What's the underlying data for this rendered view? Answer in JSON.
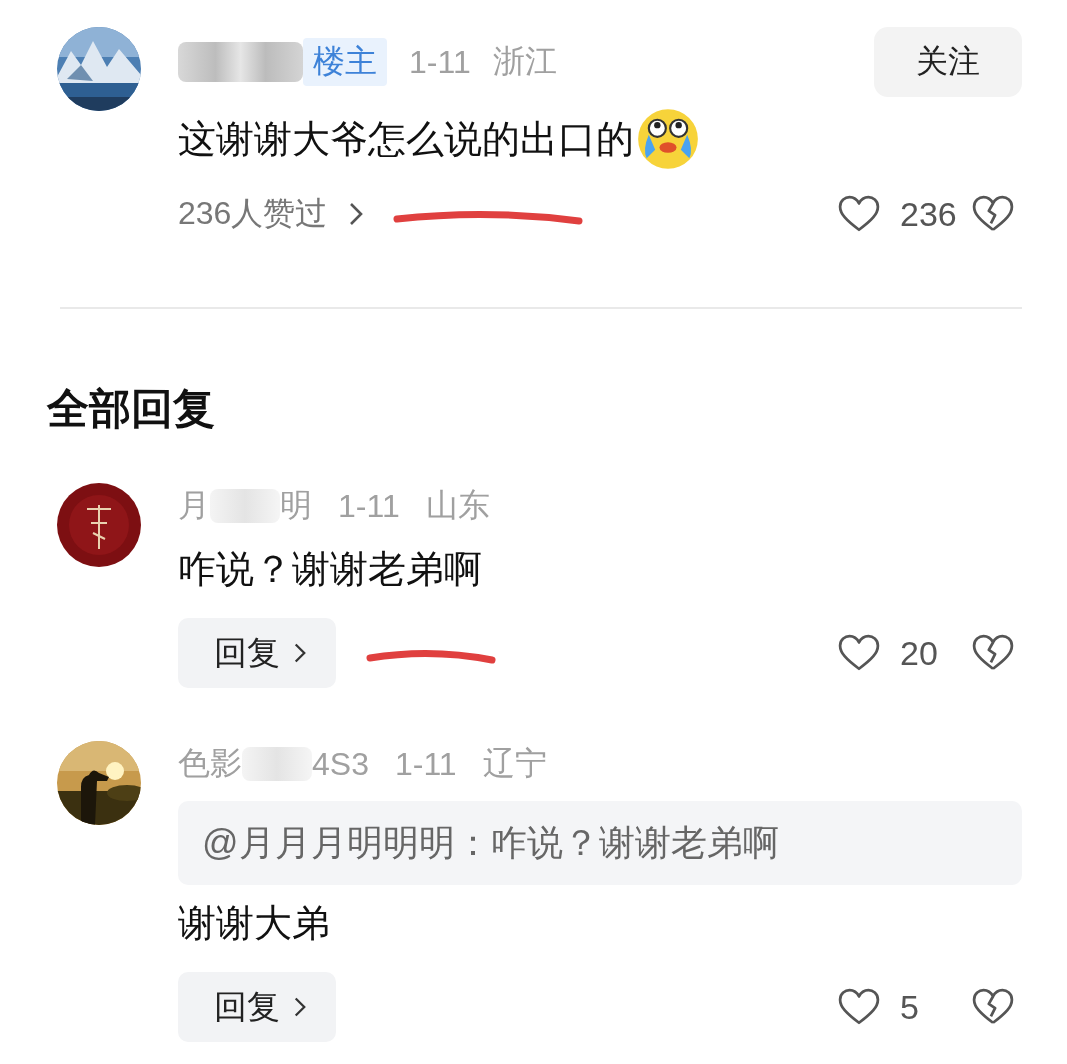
{
  "post": {
    "badge": "楼主",
    "date": "1-11",
    "location": "浙江",
    "follow_button": "关注",
    "text": "这谢谢大爷怎么说的出口的",
    "likes_summary": "236人赞过",
    "like_count": "236",
    "liked": false,
    "annotated": true
  },
  "replies_heading": "全部回复",
  "replies": [
    {
      "name_start": "月",
      "name_end": "明",
      "date": "1-11",
      "location": "山东",
      "text": "咋说？谢谢老弟啊",
      "reply_button": "回复",
      "like_count": "20",
      "liked": false,
      "annotated": true
    },
    {
      "name_start": "色影",
      "name_end": "4S3",
      "date": "1-11",
      "location": "辽宁",
      "quote": "@月月月明明明：咋说？谢谢老弟啊",
      "text": "谢谢大弟",
      "reply_button": "回复",
      "like_count": "5",
      "liked": false,
      "annotated": false
    }
  ]
}
